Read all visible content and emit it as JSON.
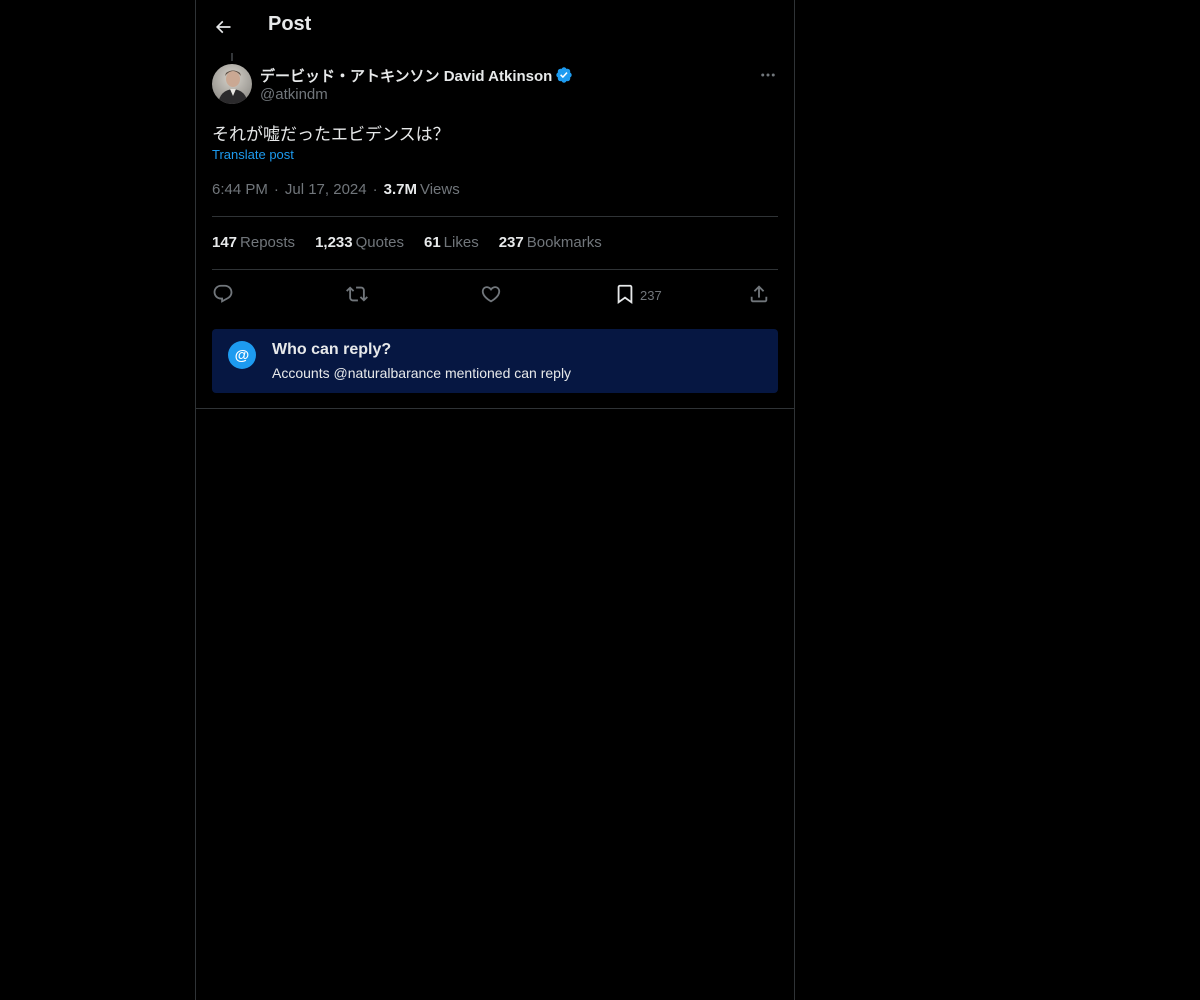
{
  "header": {
    "title": "Post"
  },
  "author": {
    "display_name": "デービッド・アトキンソン David Atkinson",
    "handle": "@atkindm",
    "verified": true
  },
  "post": {
    "text": "それが嘘だったエビデンスは？",
    "translate_label": "Translate post",
    "time": "6:44 PM",
    "date": "Jul 17, 2024",
    "views_count": "3.7M",
    "views_label": "Views"
  },
  "stats": [
    {
      "count": "147",
      "label": "Reposts"
    },
    {
      "count": "1,233",
      "label": "Quotes"
    },
    {
      "count": "61",
      "label": "Likes"
    },
    {
      "count": "237",
      "label": "Bookmarks"
    }
  ],
  "actions": {
    "bookmark_count": "237"
  },
  "reply_restriction": {
    "icon_glyph": "@",
    "title": "Who can reply?",
    "description": "Accounts @naturalbarance mentioned can reply"
  },
  "colors": {
    "background": "#000000",
    "accent": "#1d9bf0",
    "muted": "#71767b",
    "text": "#e7e9ea",
    "card": "#061742"
  }
}
